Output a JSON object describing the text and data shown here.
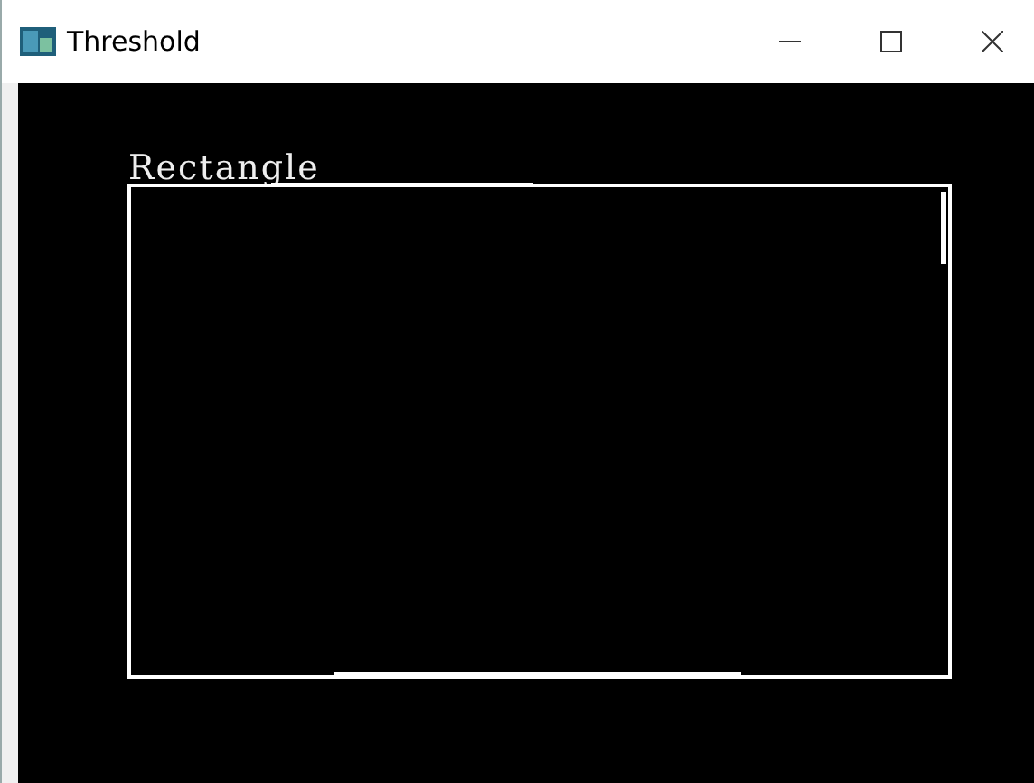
{
  "window": {
    "title": "Threshold"
  },
  "image": {
    "label": "Rectangle"
  }
}
